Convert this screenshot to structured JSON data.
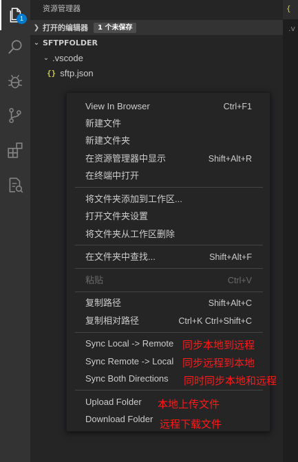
{
  "activity_bar": {
    "items": [
      {
        "icon": "files-icon",
        "badge": "1"
      },
      {
        "icon": "search-icon"
      },
      {
        "icon": "debug-icon"
      },
      {
        "icon": "source-control-icon"
      },
      {
        "icon": "extensions-icon"
      },
      {
        "icon": "remote-explorer-icon"
      }
    ]
  },
  "sidebar": {
    "title": "资源管理器",
    "open_editors": {
      "label": "打开的编辑器",
      "badge": "1 个未保存"
    },
    "folder": {
      "label": "SFTPFOLDER"
    },
    "tree": [
      {
        "label": ".vscode",
        "type": "folder"
      },
      {
        "label": "sftp.json",
        "type": "file",
        "icon_text": "{}"
      }
    ]
  },
  "editor": {
    "tab_glyph": "{",
    "line_glyph": ".v"
  },
  "context_menu": {
    "items": [
      {
        "label": "View In Browser",
        "shortcut": "Ctrl+F1"
      },
      {
        "label": "新建文件",
        "shortcut": ""
      },
      {
        "label": "新建文件夹",
        "shortcut": ""
      },
      {
        "label": "在资源管理器中显示",
        "shortcut": "Shift+Alt+R"
      },
      {
        "label": "在终端中打开",
        "shortcut": ""
      },
      {
        "label": "将文件夹添加到工作区...",
        "shortcut": ""
      },
      {
        "label": "打开文件夹设置",
        "shortcut": ""
      },
      {
        "label": "将文件夹从工作区删除",
        "shortcut": ""
      },
      {
        "label": "在文件夹中查找...",
        "shortcut": "Shift+Alt+F"
      },
      {
        "label": "粘贴",
        "shortcut": "Ctrl+V",
        "disabled": true
      },
      {
        "label": "复制路径",
        "shortcut": "Shift+Alt+C"
      },
      {
        "label": "复制相对路径",
        "shortcut": "Ctrl+K Ctrl+Shift+C"
      },
      {
        "label": "Sync Local -> Remote",
        "shortcut": ""
      },
      {
        "label": "Sync Remote -> Local",
        "shortcut": ""
      },
      {
        "label": "Sync Both Directions",
        "shortcut": ""
      },
      {
        "label": "Upload Folder",
        "shortcut": ""
      },
      {
        "label": "Download Folder",
        "shortcut": ""
      }
    ]
  },
  "annotations": [
    "同步本地到远程",
    "同步远程到本地",
    "同时同步本地和远程",
    "本地上传文件",
    "远程下载文件"
  ],
  "colors": {
    "annotation": "#ff1a1a",
    "badge": "#007acc",
    "json_icon": "#cbcb41"
  }
}
